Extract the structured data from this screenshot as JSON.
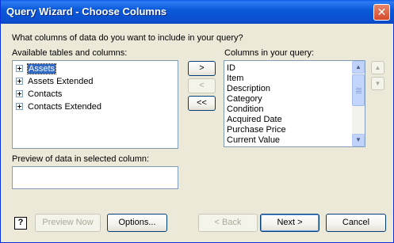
{
  "window": {
    "title": "Query Wizard - Choose Columns",
    "close_glyph": "✕"
  },
  "prompt": "What columns of data do you want to include in your query?",
  "available": {
    "label": "Available tables and columns:",
    "items": [
      {
        "label": "Assets",
        "selected": true
      },
      {
        "label": "Assets Extended",
        "selected": false
      },
      {
        "label": "Contacts",
        "selected": false
      },
      {
        "label": "Contacts Extended",
        "selected": false
      }
    ]
  },
  "move_buttons": {
    "add": ">",
    "remove": "<",
    "remove_all": "<<"
  },
  "query_columns": {
    "label": "Columns in your query:",
    "items": [
      "ID",
      "Item",
      "Description",
      "Category",
      "Condition",
      "Acquired Date",
      "Purchase Price",
      "Current Value"
    ]
  },
  "order_buttons": {
    "up": "▲",
    "down": "▼"
  },
  "preview": {
    "label": "Preview of data in selected column:",
    "value": ""
  },
  "footer": {
    "help": "?",
    "preview_now": "Preview Now",
    "options": "Options...",
    "back": "< Back",
    "next": "Next >",
    "cancel": "Cancel"
  },
  "scrollbar": {
    "up_glyph": "▲",
    "down_glyph": "▼"
  }
}
